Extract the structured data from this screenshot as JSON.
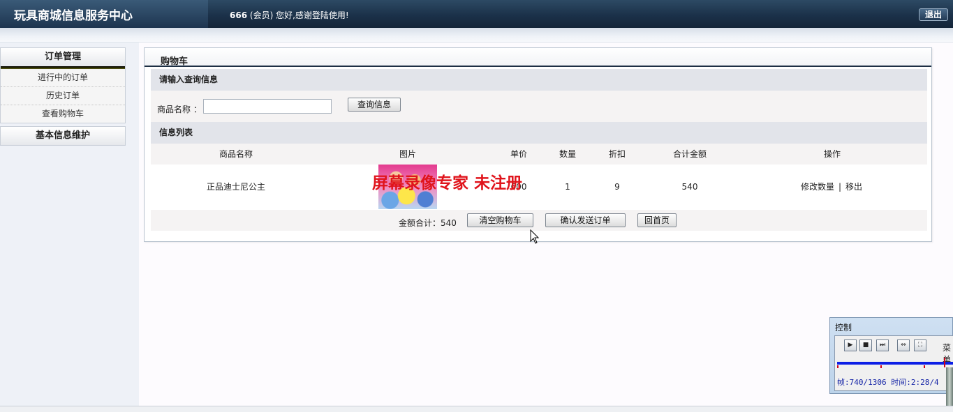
{
  "header": {
    "app_title": "玩具商城信息服务中心",
    "user_name": "666",
    "user_role": "(会员)",
    "greeting": " 您好,感谢登陆使用!",
    "logout_label": "退出"
  },
  "sidebar": {
    "sections": [
      {
        "title": "订单管理",
        "items": [
          "进行中的订单",
          "历史订单",
          "查看购物车"
        ]
      },
      {
        "title": "基本信息维护",
        "items": []
      }
    ]
  },
  "panel": {
    "title": "购物车",
    "query": {
      "section_title": "请输入查询信息",
      "name_label": "商品名称 ：",
      "name_value": "",
      "search_button": "查询信息"
    },
    "list": {
      "section_title": "信息列表",
      "columns": [
        "商品名称",
        "图片",
        "单价",
        "数量",
        "折扣",
        "合计金额",
        "操作"
      ],
      "rows": [
        {
          "name": "正品迪士尼公主",
          "image": "disney-princesses-thumbnail",
          "unit_price": "600",
          "quantity": "1",
          "discount": "9",
          "total": "540",
          "ops": {
            "edit": "修改数量",
            "separator": "|",
            "remove": "移出"
          }
        }
      ]
    },
    "footer": {
      "total_label": "金额合计：540",
      "clear_button": "清空购物车",
      "confirm_button": "确认发送订单",
      "home_button": "回首页"
    }
  },
  "watermark": "屏幕录像专家  未注册",
  "recorder": {
    "title": "控制",
    "menu_label": "菜单",
    "status": "帧:740/1306 时间:2:28/4",
    "progress": 0.57,
    "accent": "#0b1ee6"
  }
}
